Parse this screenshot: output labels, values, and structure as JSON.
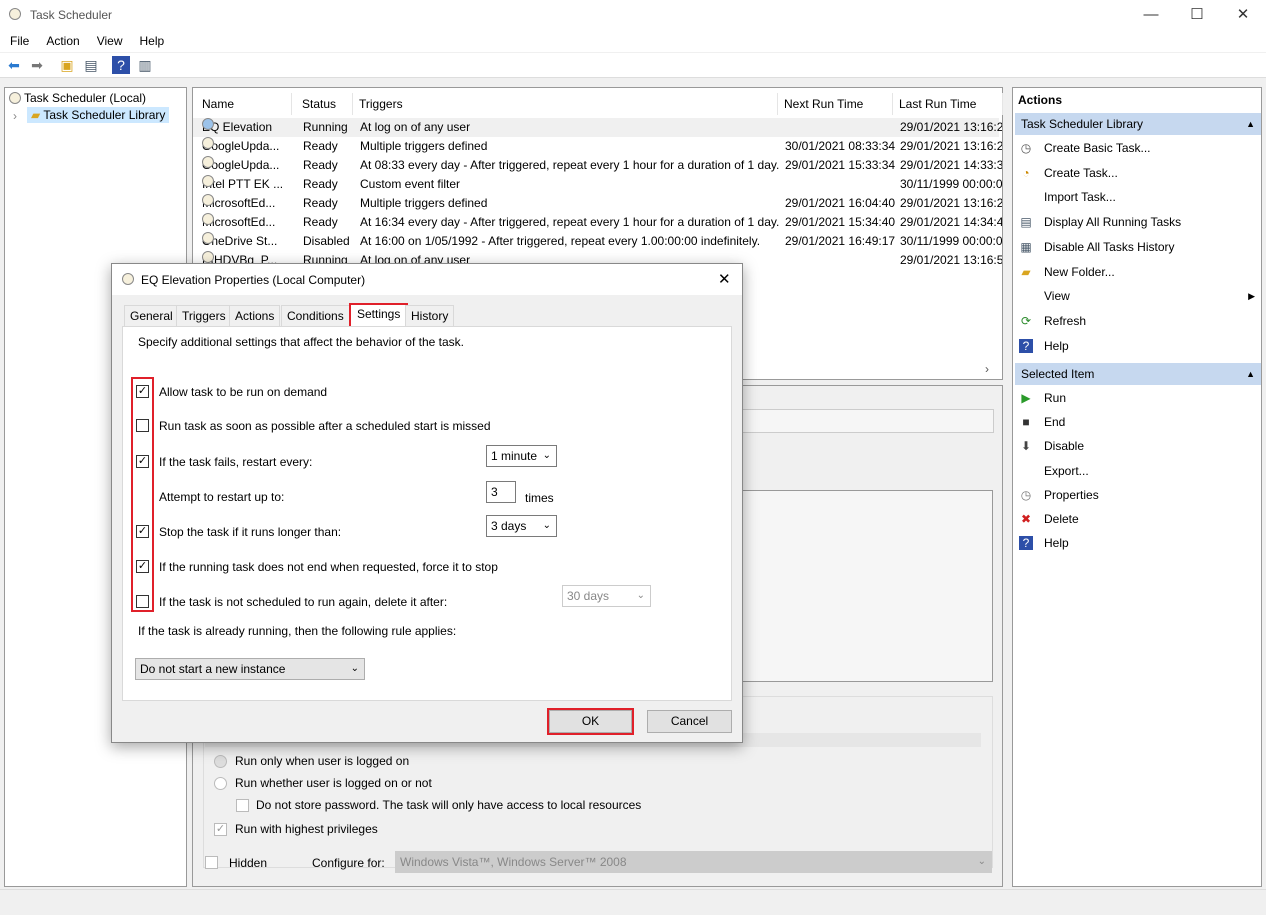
{
  "window": {
    "title": "Task Scheduler",
    "minimize": "—",
    "maximize": "☐",
    "close": "✕"
  },
  "menu": [
    "File",
    "Action",
    "View",
    "Help"
  ],
  "tree": {
    "root": "Task Scheduler (Local)",
    "child": "Task Scheduler Library"
  },
  "table": {
    "columns": [
      "Name",
      "Status",
      "Triggers",
      "Next Run Time",
      "Last Run Time"
    ],
    "rows": [
      [
        "EQ Elevation",
        "Running",
        "At log on of any user",
        "",
        "29/01/2021 13:16:23"
      ],
      [
        "GoogleUpda...",
        "Ready",
        "Multiple triggers defined",
        "30/01/2021 08:33:34",
        "29/01/2021 13:16:23"
      ],
      [
        "GoogleUpda...",
        "Ready",
        "At 08:33 every day - After triggered, repeat every 1 hour for a duration of 1 day.",
        "29/01/2021 15:33:34",
        "29/01/2021 14:33:35"
      ],
      [
        "Intel PTT EK ...",
        "Ready",
        "Custom event filter",
        "",
        "30/11/1999 00:00:00"
      ],
      [
        "MicrosoftEd...",
        "Ready",
        "Multiple triggers defined",
        "29/01/2021 16:04:40",
        "29/01/2021 13:16:23"
      ],
      [
        "MicrosoftEd...",
        "Ready",
        "At 16:34 every day - After triggered, repeat every 1 hour for a duration of 1 day.",
        "29/01/2021 15:34:40",
        "29/01/2021 14:34:41"
      ],
      [
        "OneDrive St...",
        "Disabled",
        "At 16:00 on 1/05/1992 - After triggered, repeat every 1.00:00:00 indefinitely.",
        "29/01/2021 16:49:17",
        "30/11/1999 00:00:00"
      ],
      [
        "RtHDVBg_P...",
        "Running",
        "At log on of any user",
        "",
        "29/01/2021 13:16:54"
      ]
    ]
  },
  "actions": {
    "header": "Actions",
    "section1": "Task Scheduler Library",
    "items1": [
      "Create Basic Task...",
      "Create Task...",
      "Import Task...",
      "Display All Running Tasks",
      "Disable All Tasks History",
      "New Folder...",
      "View",
      "Refresh",
      "Help"
    ],
    "section2": "Selected Item",
    "items2": [
      "Run",
      "End",
      "Disable",
      "Export...",
      "Properties",
      "Delete",
      "Help"
    ]
  },
  "background_general": {
    "run_logged_on": "Run only when user is logged on",
    "run_whether": "Run whether user is logged on or not",
    "no_store_pw": "Do not store password.  The task will only have access to local resources",
    "highest": "Run with highest privileges",
    "hidden": "Hidden",
    "configure_label": "Configure for:",
    "configure_value": "Windows Vista™, Windows Server™ 2008"
  },
  "dialog": {
    "title": "EQ Elevation Properties (Local Computer)",
    "tabs": [
      "General",
      "Triggers",
      "Actions",
      "Conditions",
      "Settings",
      "History"
    ],
    "active_tab": "Settings",
    "intro": "Specify additional settings that affect the behavior of the task.",
    "allow_demand": {
      "label": "Allow task to be run on demand",
      "checked": true
    },
    "run_asap": {
      "label": "Run task as soon as possible after a scheduled start is missed",
      "checked": false
    },
    "restart_every": {
      "label": "If the task fails, restart every:",
      "checked": true,
      "value": "1 minute"
    },
    "restart_attempts": {
      "label": "Attempt to restart up to:",
      "value": "3",
      "unit": "times"
    },
    "stop_longer": {
      "label": "Stop the task if it runs longer than:",
      "checked": true,
      "value": "3 days"
    },
    "force_stop": {
      "label": "If the running task does not end when requested, force it to stop",
      "checked": true
    },
    "delete_after": {
      "label": "If the task is not scheduled to run again, delete it after:",
      "checked": false,
      "value": "30 days"
    },
    "rule_label": "If the task is already running, then the following rule applies:",
    "rule_value": "Do not start a new instance",
    "ok": "OK",
    "cancel": "Cancel"
  },
  "colors": {
    "highlight": "#e0202a",
    "section_bg": "#c6d8ef"
  }
}
